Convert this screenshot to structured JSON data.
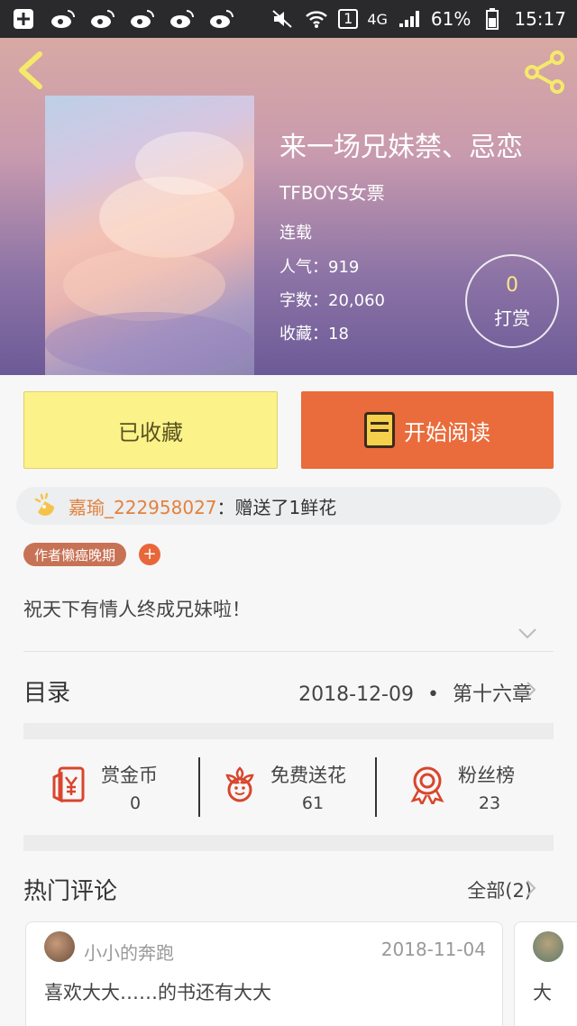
{
  "status_bar": {
    "network": "4G",
    "battery": "61%",
    "time": "15:17",
    "sim": "1"
  },
  "header": {
    "book_title": "来一场兄妹禁、忌恋",
    "author": "TFBOYS女票",
    "status": "连载",
    "popularity_label": "人气：",
    "popularity": "919",
    "word_count_label": "字数：",
    "word_count": "20,060",
    "favorites_label": "收藏：",
    "favorites": "18",
    "tip_count": "0",
    "tip_label": "打赏"
  },
  "actions": {
    "collected_label": "已收藏",
    "read_label": "开始阅读"
  },
  "gift_banner": {
    "user": "嘉瑜_222958027",
    "message": "：赠送了1鲜花"
  },
  "author_tag": "作者懒癌晚期",
  "add_tag": "+",
  "intro": "祝天下有情人终成兄妹啦！",
  "catalog": {
    "label": "目录",
    "date": "2018-12-09",
    "separator": "•",
    "chapter": "第十六章"
  },
  "stats": [
    {
      "label": "赏金币",
      "value": "0",
      "icon": "reward-coin-icon"
    },
    {
      "label": "免费送花",
      "value": "61",
      "icon": "flower-icon"
    },
    {
      "label": "粉丝榜",
      "value": "23",
      "icon": "medal-icon"
    }
  ],
  "hot_comments": {
    "title": "热门评论",
    "all_link": "全部(2)",
    "items": [
      {
        "user": "小小的奔跑",
        "date": "2018-11-04",
        "text": "喜欢大大……的书还有大大"
      },
      {
        "user": "",
        "date": "",
        "text": "大"
      }
    ]
  },
  "colors": {
    "accent_orange": "#ea6b3b",
    "collected_yellow": "#fbf28a",
    "tag_brown": "#c87255",
    "gift_user": "#e2823e"
  }
}
